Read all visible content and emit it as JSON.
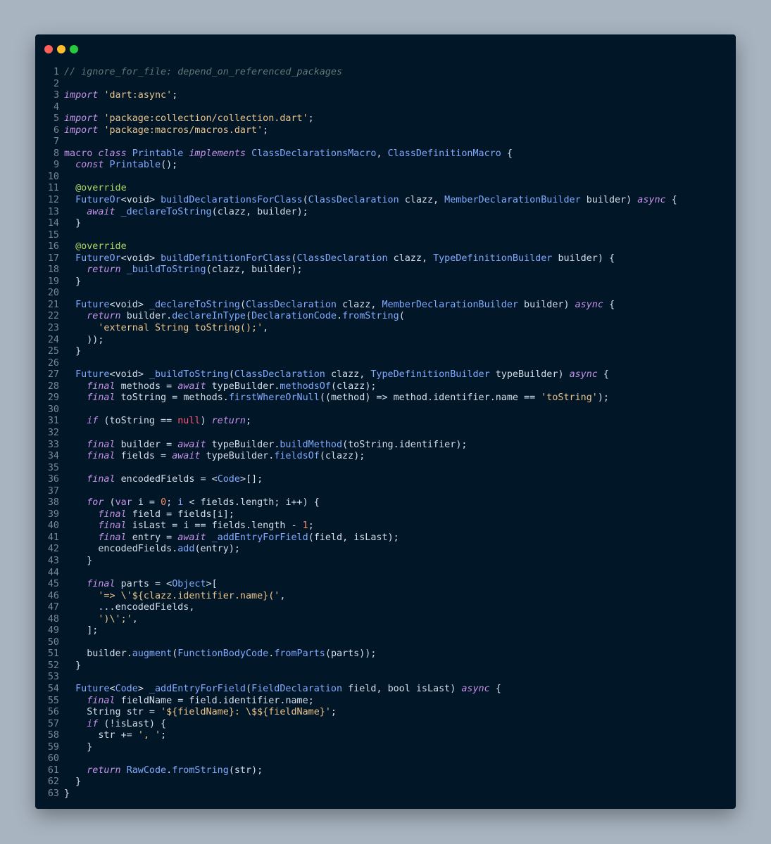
{
  "window": {
    "controls": {
      "close_color": "#ff5f56",
      "minimize_color": "#ffbd2e",
      "maximize_color": "#27c93f"
    }
  },
  "code": {
    "language": "dart",
    "lines": [
      "// ignore_for_file: depend_on_referenced_packages",
      "",
      "import 'dart:async';",
      "",
      "import 'package:collection/collection.dart';",
      "import 'package:macros/macros.dart';",
      "",
      "macro class Printable implements ClassDeclarationsMacro, ClassDefinitionMacro {",
      "  const Printable();",
      "",
      "  @override",
      "  FutureOr<void> buildDeclarationsForClass(ClassDeclaration clazz, MemberDeclarationBuilder builder) async {",
      "    await _declareToString(clazz, builder);",
      "  }",
      "",
      "  @override",
      "  FutureOr<void> buildDefinitionForClass(ClassDeclaration clazz, TypeDefinitionBuilder builder) {",
      "    return _buildToString(clazz, builder);",
      "  }",
      "",
      "  Future<void> _declareToString(ClassDeclaration clazz, MemberDeclarationBuilder builder) async {",
      "    return builder.declareInType(DeclarationCode.fromString(",
      "      'external String toString();',",
      "    ));",
      "  }",
      "",
      "  Future<void> _buildToString(ClassDeclaration clazz, TypeDefinitionBuilder typeBuilder) async {",
      "    final methods = await typeBuilder.methodsOf(clazz);",
      "    final toString = methods.firstWhereOrNull((method) => method.identifier.name == 'toString');",
      "",
      "    if (toString == null) return;",
      "",
      "    final builder = await typeBuilder.buildMethod(toString.identifier);",
      "    final fields = await typeBuilder.fieldsOf(clazz);",
      "",
      "    final encodedFields = <Code>[];",
      "",
      "    for (var i = 0; i < fields.length; i++) {",
      "      final field = fields[i];",
      "      final isLast = i == fields.length - 1;",
      "      final entry = await _addEntryForField(field, isLast);",
      "      encodedFields.add(entry);",
      "    }",
      "",
      "    final parts = <Object>[",
      "      '=> \\'${clazz.identifier.name}(',",
      "      ...encodedFields,",
      "      ')\\';',",
      "    ];",
      "",
      "    builder.augment(FunctionBodyCode.fromParts(parts));",
      "  }",
      "",
      "  Future<Code> _addEntryForField(FieldDeclaration field, bool isLast) async {",
      "    final fieldName = field.identifier.name;",
      "    String str = '${fieldName}: \\$${fieldName}';",
      "    if (!isLast) {",
      "      str += ', ';",
      "    }",
      "",
      "    return RawCode.fromString(str);",
      "  }",
      "}"
    ]
  }
}
